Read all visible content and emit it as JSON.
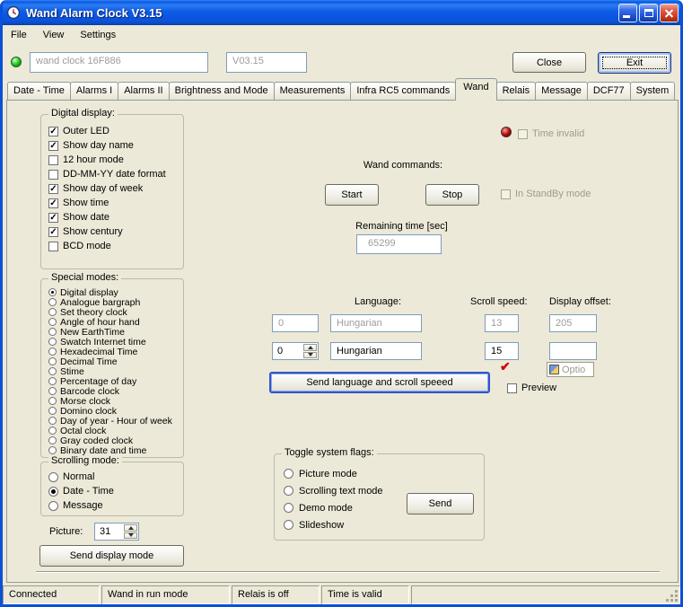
{
  "window": {
    "title": "Wand Alarm Clock V3.15"
  },
  "menu": [
    "File",
    "View",
    "Settings"
  ],
  "header": {
    "device_name": "wand clock 16F886",
    "version": "V03.15",
    "close_button": "Close",
    "exit_button": "Exit"
  },
  "tabs": [
    "Date - Time",
    "Alarms I",
    "Alarms II",
    "Brightness and Mode",
    "Measurements",
    "Infra RC5 commands",
    "Wand",
    "Relais",
    "Message",
    "DCF77",
    "System"
  ],
  "selected_tab": "Wand",
  "digital_display": {
    "title": "Digital display:",
    "items": [
      {
        "label": "Outer LED",
        "checked": true
      },
      {
        "label": "Show day name",
        "checked": true
      },
      {
        "label": "12 hour mode",
        "checked": false
      },
      {
        "label": "DD-MM-YY date format",
        "checked": false
      },
      {
        "label": "Show day of week",
        "checked": true
      },
      {
        "label": "Show time",
        "checked": true
      },
      {
        "label": "Show date",
        "checked": true
      },
      {
        "label": "Show century",
        "checked": true
      },
      {
        "label": "BCD mode",
        "checked": false
      }
    ]
  },
  "special_modes": {
    "title": "Special modes:",
    "selected": "Digital display",
    "items": [
      "Digital display",
      "Analogue bargraph",
      "Set theory clock",
      "Angle of hour hand",
      "New EarthTime",
      "Swatch Internet time",
      "Hexadecimal Time",
      "Decimal Time",
      "Stime",
      "Percentage of day",
      "Barcode clock",
      "Morse clock",
      "Domino clock",
      "Day of year - Hour of week",
      "Octal clock",
      "Gray coded clock",
      "Binary date and time"
    ]
  },
  "scrolling_mode": {
    "title": "Scrolling mode:",
    "selected": "Date - Time",
    "items": [
      "Normal",
      "Date - Time",
      "Message"
    ]
  },
  "picture": {
    "label": "Picture:",
    "value": "31"
  },
  "send_display_mode_button": "Send display mode",
  "wand": {
    "time_invalid_label": "Time invalid",
    "commands_label": "Wand commands:",
    "start_button": "Start",
    "stop_button": "Stop",
    "standby_label": "In StandBy mode",
    "remaining_label": "Remaining time [sec]",
    "remaining_value": "65299",
    "language_label": "Language:",
    "scroll_speed_label": "Scroll speed:",
    "display_offset_label": "Display offset:",
    "row1": {
      "index": "0",
      "language": "Hungarian",
      "speed": "13",
      "offset": "205"
    },
    "row2": {
      "index": "0",
      "language": "Hungarian",
      "speed": "15",
      "offset": ""
    },
    "send_language_button": "Send language and scroll speeed",
    "partial_control_text": "Optio",
    "preview_label": "Preview"
  },
  "toggle_flags": {
    "title": "Toggle system flags:",
    "selected": "",
    "items": [
      "Picture mode",
      "Scrolling text mode",
      "Demo mode",
      "Slideshow"
    ],
    "send_button": "Send"
  },
  "statusbar": {
    "panels": [
      "Connected",
      "Wand in run mode",
      "Relais is off",
      "Time is valid",
      ""
    ]
  },
  "icons": {
    "red_check": "✔"
  }
}
